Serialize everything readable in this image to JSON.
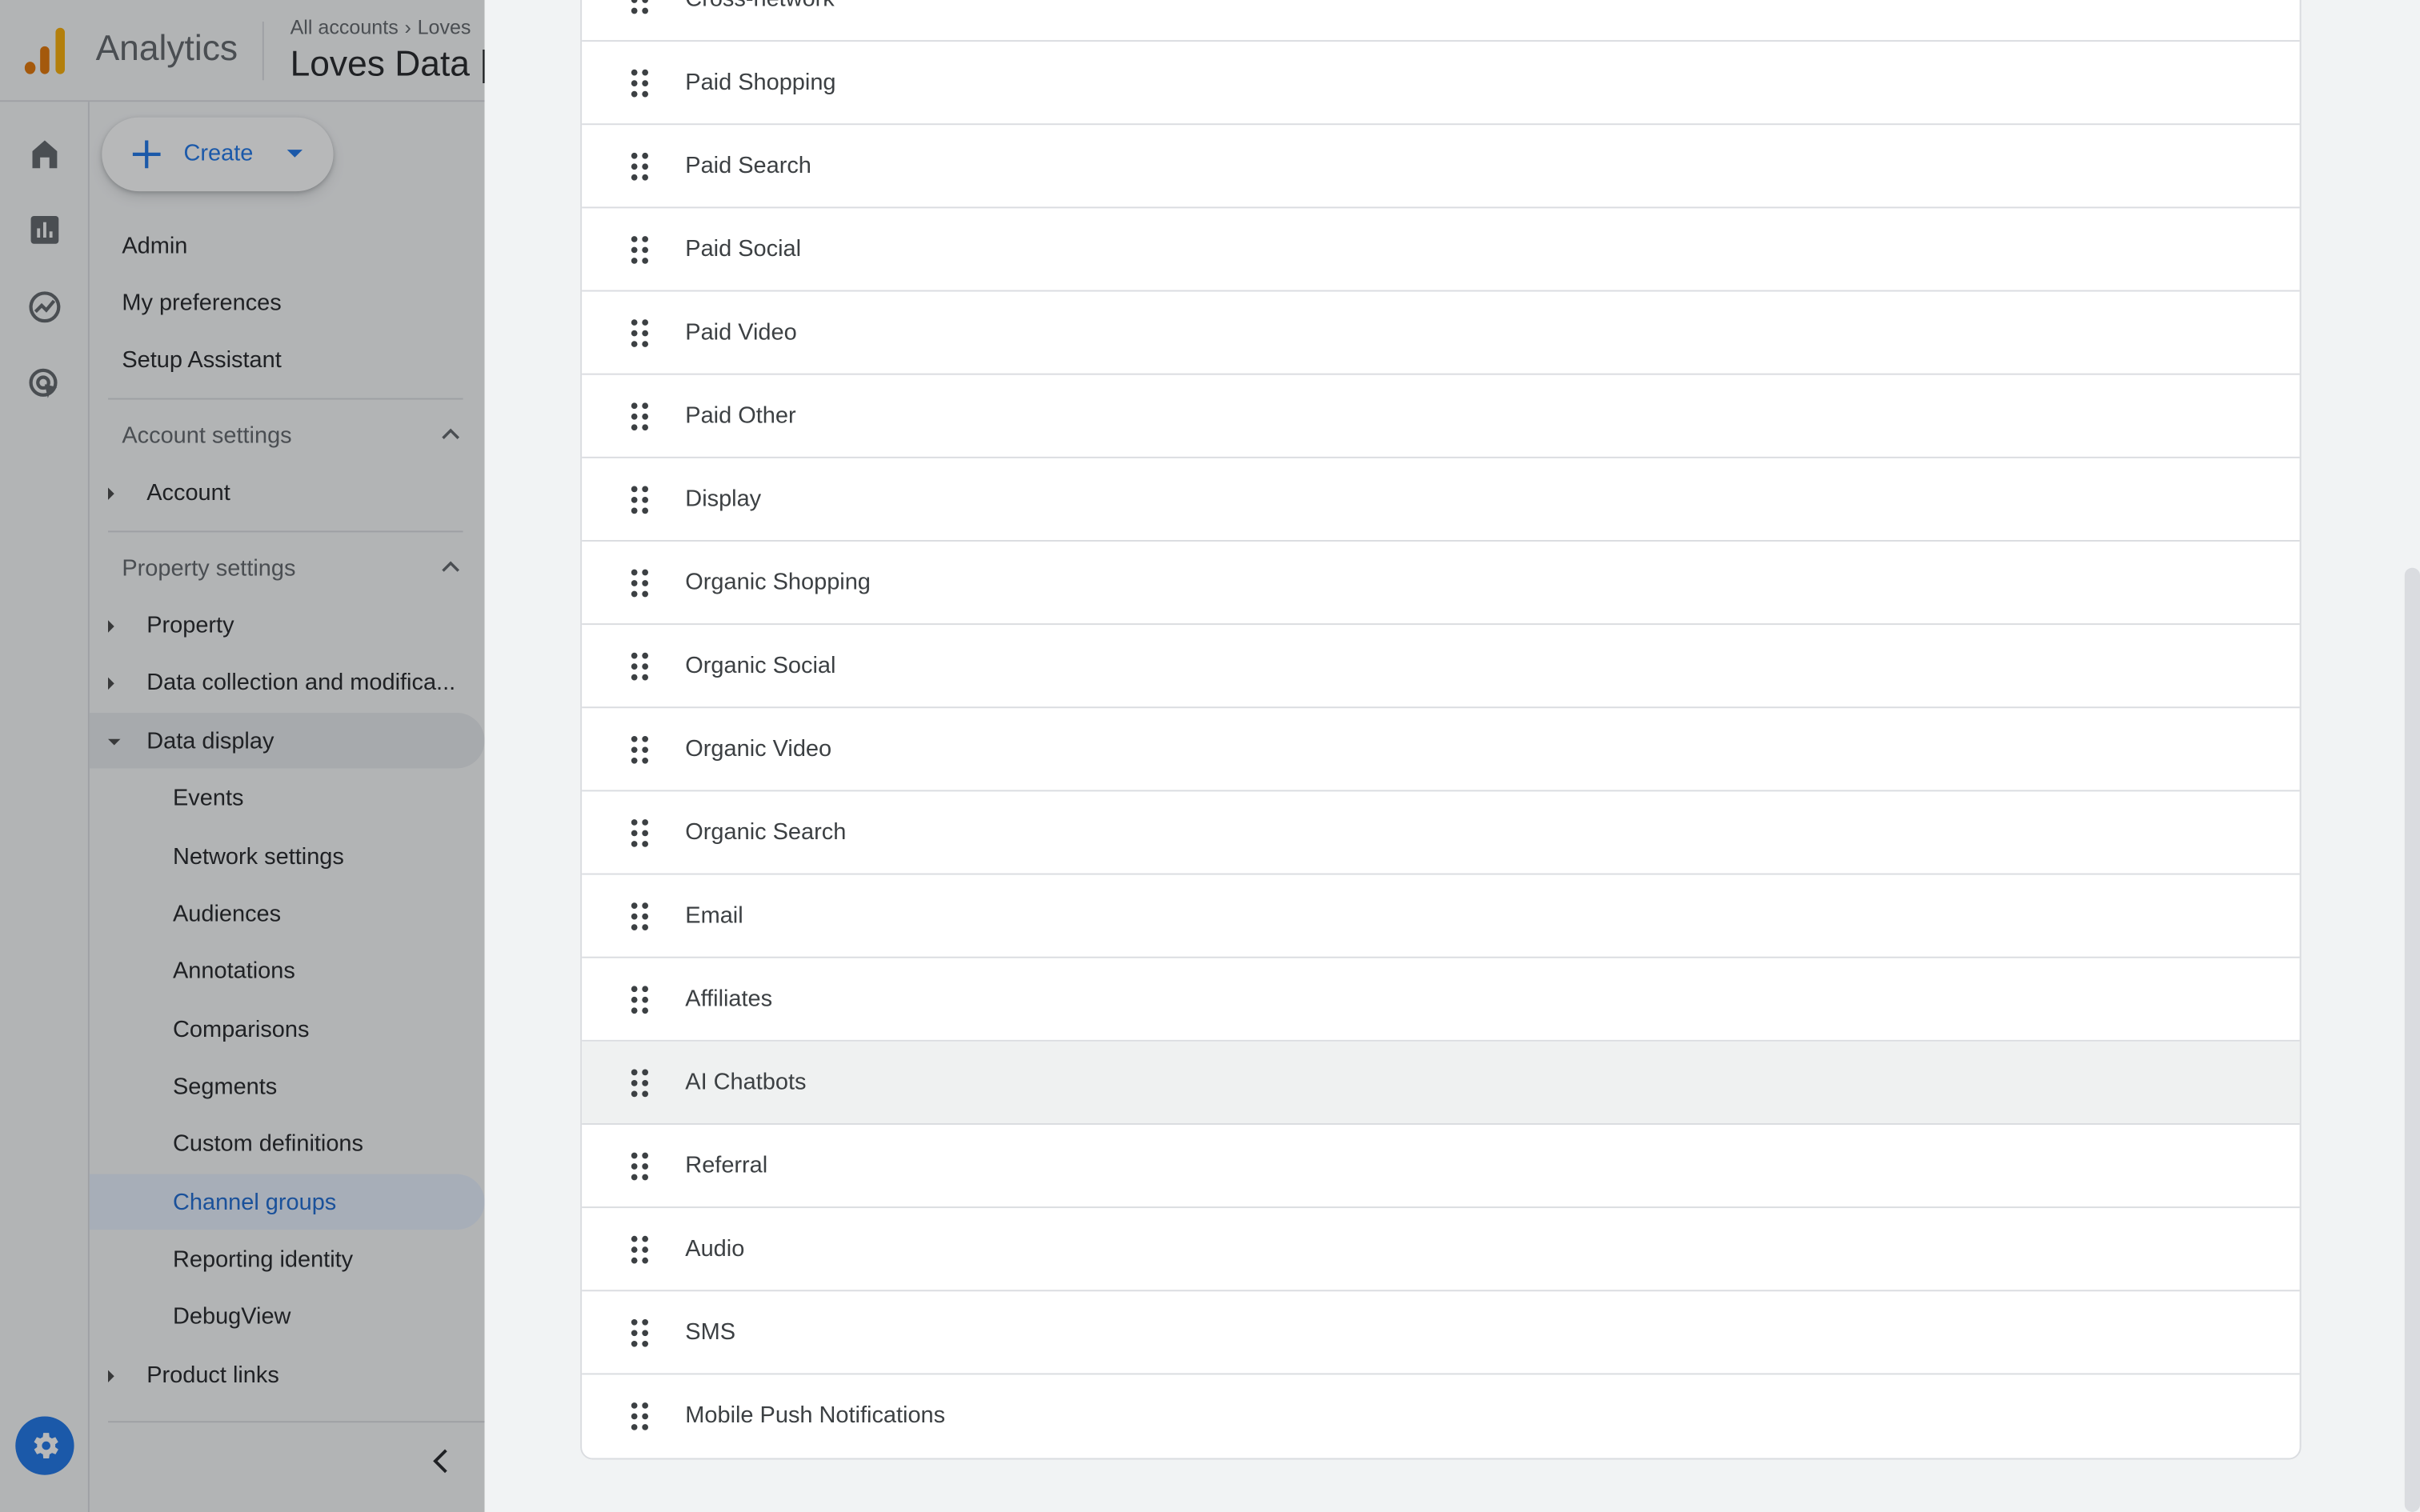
{
  "header": {
    "app_name": "Analytics",
    "breadcrumb": [
      "All accounts",
      "Loves"
    ],
    "property_title": "Loves Data |"
  },
  "rail": {
    "icons": [
      "home-icon",
      "reports-icon",
      "explore-icon",
      "advertising-icon"
    ],
    "settings_icon": "gear-icon"
  },
  "nav": {
    "create_label": "Create",
    "top_items": [
      "Admin",
      "My preferences",
      "Setup Assistant"
    ],
    "account_settings": {
      "label": "Account settings",
      "items": [
        "Account"
      ]
    },
    "property_settings": {
      "label": "Property settings",
      "items": [
        "Property",
        "Data collection and modifica...",
        "Data display"
      ]
    },
    "data_display_items": [
      "Events",
      "Network settings",
      "Audiences",
      "Annotations",
      "Comparisons",
      "Segments",
      "Custom definitions",
      "Channel groups",
      "Reporting identity",
      "DebugView"
    ],
    "selected_item": "Channel groups",
    "product_links": "Product links"
  },
  "channels": {
    "partial_top": "Cross-network",
    "rows": [
      "Paid Shopping",
      "Paid Search",
      "Paid Social",
      "Paid Video",
      "Paid Other",
      "Display",
      "Organic Shopping",
      "Organic Social",
      "Organic Video",
      "Organic Search",
      "Email",
      "Affiliates",
      "AI Chatbots",
      "Referral",
      "Audio",
      "SMS",
      "Mobile Push Notifications"
    ],
    "hovered_row": "AI Chatbots"
  },
  "colors": {
    "accent": "#1a73e8",
    "selected_nav_bg": "#e8f0fe",
    "overlay": "rgba(32,33,36,0.32)"
  }
}
